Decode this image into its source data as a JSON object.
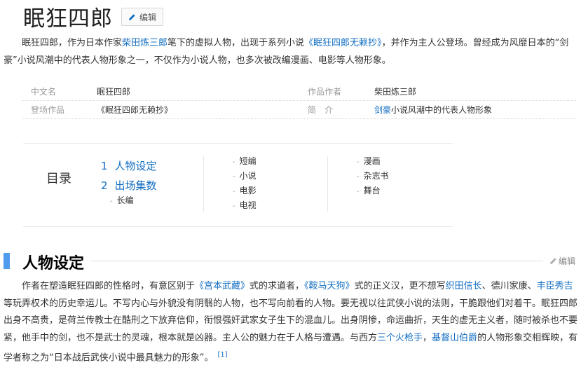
{
  "page": {
    "title": "眠狂四郎",
    "edit_label": "编辑"
  },
  "summary": {
    "p1": "眠狂四郎，作为日本作家",
    "author_link": "柴田炼三郎",
    "p2": "笔下的虚拟人物，出现于系列小说",
    "novel_link": "《眠狂四郎无赖抄》",
    "p3": "，并作为主人公登场。曾经成为风靡日本的“剑豪”小说风潮中的代表人物形象之一，不仅作为小说人物，也多次被改编漫画、电影等人物形象。"
  },
  "basic_info": {
    "rows": [
      {
        "name1": "中文名",
        "value1": "眠狂四郎",
        "name2": "作品作者",
        "value2": "柴田炼三郎"
      },
      {
        "name1": "登场作品",
        "value1": "《眠狂四郎无赖抄》",
        "name2": "简　介",
        "value2_link": "剑豪",
        "value2_rest": "小说风潮中的代表人物形象"
      }
    ]
  },
  "toc": {
    "label": "目录",
    "level1": [
      {
        "num": "1",
        "label": "人物设定"
      },
      {
        "num": "2",
        "label": "出场集数"
      }
    ],
    "sub_under_2": [
      "长编"
    ],
    "col2": [
      "短编",
      "小说",
      "电影",
      "电视"
    ],
    "col3": [
      "漫画",
      "杂志书",
      "舞台"
    ]
  },
  "section": {
    "title": "人物设定",
    "edit_label": "编辑",
    "para": {
      "t1": "作者在塑造眠狂四郎的性格时，有意区别于",
      "l1": "《宫本武藏》",
      "t2": "式的求道者，",
      "l2": "《鞍马天狗》",
      "t3": "式的正义汉，更不想写",
      "l3": "织田信长",
      "t4": "、德川家康、",
      "l4": "丰臣秀吉",
      "t5": "等玩弄权术的历史幸运儿。不写内心与外貌没有阴翳的人物，也不写向前看的人物。要无视以往武侠小说的法则，干脆跟他们对着干。眠狂四郎出身不高贵，是荷兰传教士在酷刑之下放弃信仰，衔恨强奸武家女子生下的混血儿。出身阴惨，命运曲折，天生的虚无主义者，随时被杀也不要紧，他手中的剑，也不是武士的灵魂，根本就是凶器。主人公的魅力在于人格与遭遇。与西方",
      "l5": "三个火枪手",
      "t6": "，",
      "l6": "基督山伯爵",
      "t7": "的人物形象交相辉映，有学者称之为“日本战后武侠小说中最具魅力的形象”。",
      "ref": "[1]"
    }
  }
}
